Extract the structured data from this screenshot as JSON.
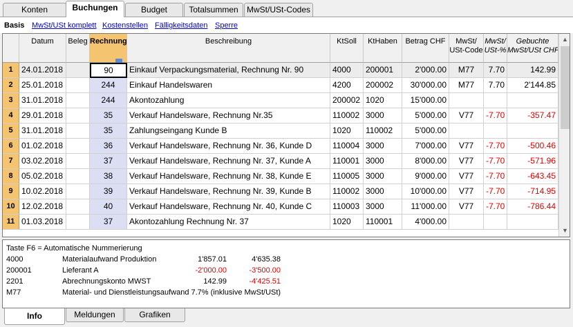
{
  "tabs": [
    "Konten",
    "Buchungen",
    "Budget",
    "Totalsummen",
    "MwSt/USt-Codes"
  ],
  "views": [
    "Basis",
    "MwSt/USt komplett",
    "Kostenstellen",
    "Fälligkeitsdaten",
    "Sperre"
  ],
  "columns": {
    "datum": "Datum",
    "beleg": "Beleg",
    "rechnung": "Rechnung",
    "beschreibung": "Beschreibung",
    "ktsoll": "KtSoll",
    "kthaben": "KtHaben",
    "betrag": "Betrag CHF",
    "mwst_code_1": "MwSt/",
    "mwst_code_2": "USt-Code",
    "mwst_pct_1": "MwSt/",
    "mwst_pct_2": "USt-%",
    "gebucht_1": "Gebuchte",
    "gebucht_2": "MwSt/USt CHF"
  },
  "rows": [
    {
      "n": "1",
      "datum": "24.01.2018",
      "beleg": "",
      "rechnung": "90",
      "beschreibung": "Einkauf Verpackungsmaterial, Rechnung Nr. 90",
      "ktsoll": "4000",
      "kthaben": "200001",
      "betrag": "2'000.00",
      "code": "M77",
      "pct": "7.70",
      "gebucht": "142.99"
    },
    {
      "n": "2",
      "datum": "25.01.2018",
      "beleg": "",
      "rechnung": "244",
      "beschreibung": "Einkauf Handelswaren",
      "ktsoll": "4200",
      "kthaben": "200002",
      "betrag": "30'000.00",
      "code": "M77",
      "pct": "7.70",
      "gebucht": "2'144.85"
    },
    {
      "n": "3",
      "datum": "31.01.2018",
      "beleg": "",
      "rechnung": "244",
      "beschreibung": "Akontozahlung",
      "ktsoll": "200002",
      "kthaben": "1020",
      "betrag": "15'000.00",
      "code": "",
      "pct": "",
      "gebucht": ""
    },
    {
      "n": "4",
      "datum": "29.01.2018",
      "beleg": "",
      "rechnung": "35",
      "beschreibung": "Verkauf Handelsware, Rechnung Nr.35",
      "ktsoll": "110002",
      "kthaben": "3000",
      "betrag": "5'000.00",
      "code": "V77",
      "pct": "-7.70",
      "gebucht": "-357.47"
    },
    {
      "n": "5",
      "datum": "31.01.2018",
      "beleg": "",
      "rechnung": "35",
      "beschreibung": "Zahlungseingang Kunde B",
      "ktsoll": "1020",
      "kthaben": "110002",
      "betrag": "5'000.00",
      "code": "",
      "pct": "",
      "gebucht": ""
    },
    {
      "n": "6",
      "datum": "01.02.2018",
      "beleg": "",
      "rechnung": "36",
      "beschreibung": "Verkauf Handelsware, Rechnung Nr. 36, Kunde D",
      "ktsoll": "110004",
      "kthaben": "3000",
      "betrag": "7'000.00",
      "code": "V77",
      "pct": "-7.70",
      "gebucht": "-500.46"
    },
    {
      "n": "7",
      "datum": "03.02.2018",
      "beleg": "",
      "rechnung": "37",
      "beschreibung": "Verkauf Handelsware, Rechnung Nr. 37, Kunde A",
      "ktsoll": "110001",
      "kthaben": "3000",
      "betrag": "8'000.00",
      "code": "V77",
      "pct": "-7.70",
      "gebucht": "-571.96"
    },
    {
      "n": "8",
      "datum": "05.02.2018",
      "beleg": "",
      "rechnung": "38",
      "beschreibung": "Verkauf Handelsware, Rechnung Nr. 38, Kunde E",
      "ktsoll": "110005",
      "kthaben": "3000",
      "betrag": "9'000.00",
      "code": "V77",
      "pct": "-7.70",
      "gebucht": "-643.45"
    },
    {
      "n": "9",
      "datum": "10.02.2018",
      "beleg": "",
      "rechnung": "39",
      "beschreibung": "Verkauf Handelsware, Rechnung Nr. 39, Kunde B",
      "ktsoll": "110002",
      "kthaben": "3000",
      "betrag": "10'000.00",
      "code": "V77",
      "pct": "-7.70",
      "gebucht": "-714.95"
    },
    {
      "n": "10",
      "datum": "12.02.2018",
      "beleg": "",
      "rechnung": "40",
      "beschreibung": "Verkauf Handelsware, Rechnung Nr. 40, Kunde C",
      "ktsoll": "110003",
      "kthaben": "3000",
      "betrag": "11'000.00",
      "code": "V77",
      "pct": "-7.70",
      "gebucht": "-786.44"
    },
    {
      "n": "11",
      "datum": "01.03.2018",
      "beleg": "",
      "rechnung": "37",
      "beschreibung": "Akontozahlung Rechnung Nr. 37",
      "ktsoll": "1020",
      "kthaben": "110001",
      "betrag": "4'000.00",
      "code": "",
      "pct": "",
      "gebucht": ""
    }
  ],
  "info": {
    "hint": "Taste F6 = Automatische Nummerierung",
    "lines": [
      {
        "acct": "4000",
        "desc": "Materialaufwand Produktion",
        "v1": "1'857.01",
        "v2": "4'635.38"
      },
      {
        "acct": "200001",
        "desc": "Lieferant A",
        "v1": "-2'000.00",
        "v2": "-3'500.00"
      },
      {
        "acct": "2201",
        "desc": "Abrechnungskonto MWST",
        "v1": "142.99",
        "v2": "-4'425.51"
      }
    ],
    "vat": {
      "code": "M77",
      "desc": "Material- und Dienstleistungsaufwand 7.7% (inklusive MwSt/USt)"
    }
  },
  "bottom_tabs": [
    "Info",
    "Meldungen",
    "Grafiken"
  ]
}
